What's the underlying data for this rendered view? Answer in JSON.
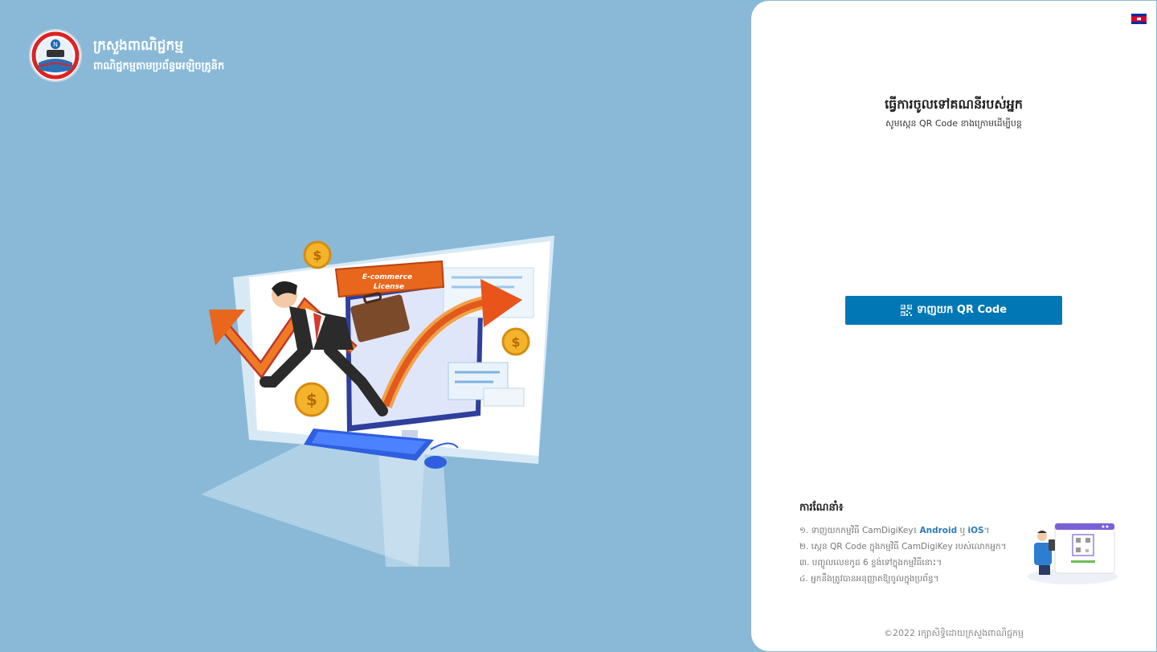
{
  "ministry": {
    "name": "ក្រសួងពាណិជ្ជកម្ម",
    "subtitle": "ពាណិជ្ជកម្មតាមប្រព័ន្ធអេឡិចត្រូនិក",
    "logo_icon": "ministry-seal-icon"
  },
  "hero": {
    "sign_line1": "E-commerce",
    "sign_line2": "License",
    "coin_symbol": "$"
  },
  "login": {
    "language_flag_icon": "cambodia-flag-icon",
    "title": "ធ្វើការចូលទៅគណនីរបស់អ្នក",
    "subtitle": "សូមស្កេន QR Code ខាងក្រោមដើម្បីបន្ត",
    "button_label": "ទាញយក QR Code",
    "button_icon": "qr-code-icon",
    "button_color": "#0277b5"
  },
  "instructions": {
    "heading": "ការណែនាំ៖",
    "step1_prefix": "១.  ទាញយកកម្មវិធី CamDigiKey៖ ",
    "step1_android": "Android",
    "step1_or": " ឬ ",
    "step1_ios": "iOS",
    "step1_suffix": "។",
    "step2": "២.  ស្កេន QR Code ក្នុងកម្មវិធី CamDigiKey របស់លោកអ្នក។",
    "step3": "៣.  បញ្ចូលលេខកូដ 6 ខ្ទង់ទៅក្នុងកម្មវិធីនោះ។",
    "step4": "៤.  អ្នកនឹងត្រូវបានអនុញ្ញាតឱ្យចូលក្នុងប្រព័ន្ធ។"
  },
  "footer": {
    "copyright": "©2022 រក្សាសិទ្ធិដោយក្រសួងពាណិជ្ជកម្ម"
  }
}
